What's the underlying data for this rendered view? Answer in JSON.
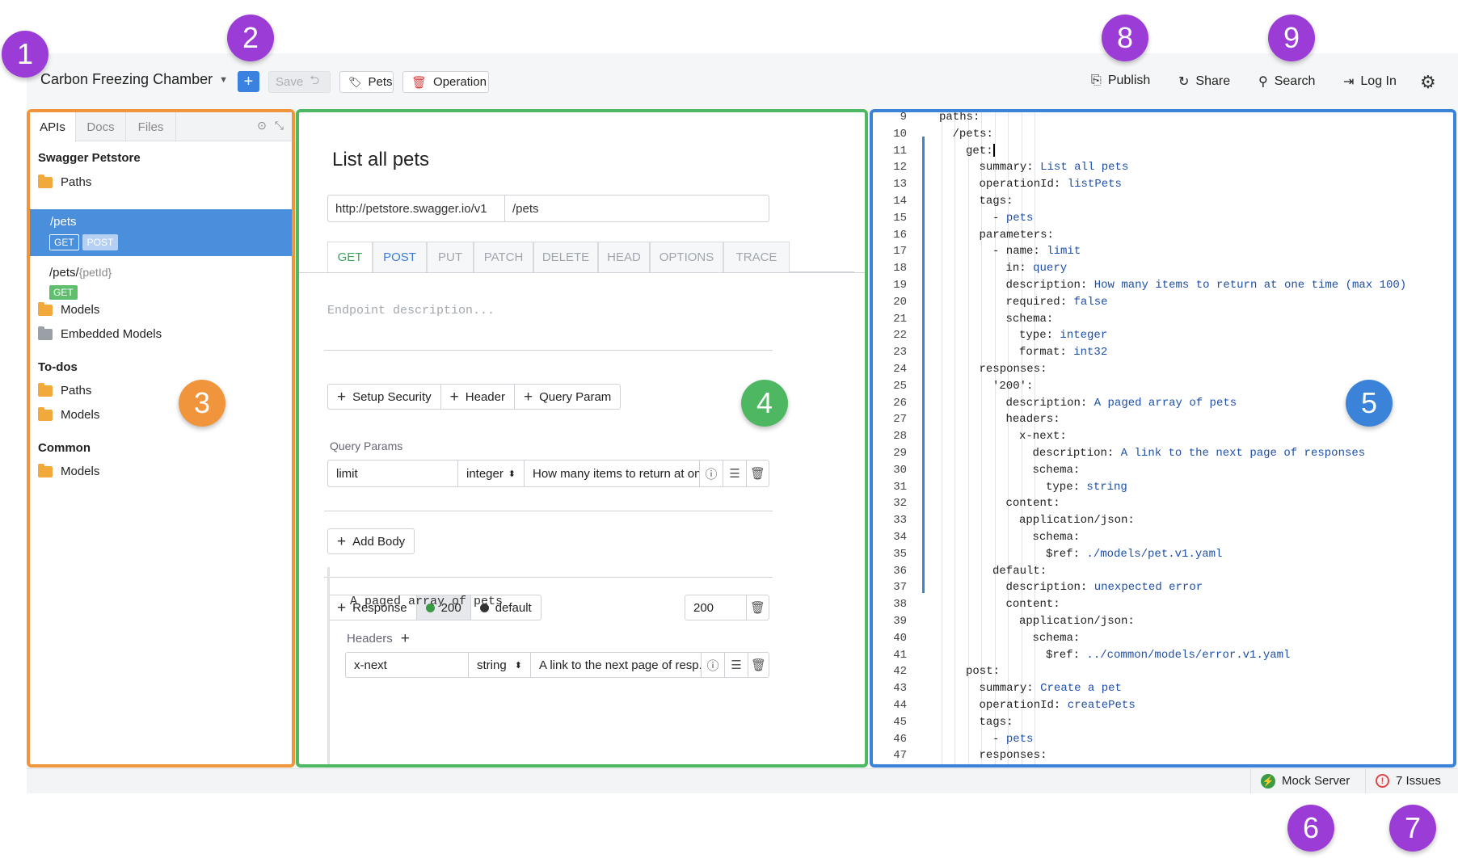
{
  "toolbar": {
    "project_title": "Carbon Freezing Chamber",
    "add_label": "+",
    "save_label": "Save",
    "pets_label": "Pets",
    "operation_label": "Operation",
    "publish_label": "Publish",
    "share_label": "Share",
    "search_label": "Search",
    "login_label": "Log In"
  },
  "callouts": [
    "1",
    "2",
    "3",
    "4",
    "5",
    "6",
    "7",
    "8",
    "9"
  ],
  "sidebar": {
    "tabs": [
      "APIs",
      "Docs",
      "Files"
    ],
    "sections": [
      {
        "title": "Swagger Petstore",
        "items": [
          "Paths"
        ]
      },
      {
        "title": "To-dos",
        "items": [
          "Paths",
          "Models"
        ]
      },
      {
        "title": "Common",
        "items": [
          "Models"
        ]
      }
    ],
    "paths": [
      {
        "path": "/pets",
        "methods": [
          "GET",
          "POST"
        ]
      },
      {
        "path_prefix": "/pets/",
        "path_param": "{petId}",
        "methods": [
          "GET"
        ]
      }
    ],
    "models_label": "Models",
    "embedded_models_label": "Embedded Models"
  },
  "operation": {
    "title": "List all pets",
    "base_url": "http://petstore.swagger.io/v1",
    "path": "/pets",
    "methods": [
      "GET",
      "POST",
      "PUT",
      "PATCH",
      "DELETE",
      "HEAD",
      "OPTIONS",
      "TRACE"
    ],
    "description_placeholder": "Endpoint description...",
    "setup_security": "Setup Security",
    "header": "Header",
    "query_param": "Query Param",
    "query_params_label": "Query Params",
    "query_param_row": {
      "name": "limit",
      "type": "integer",
      "description": "How many items to return at on..."
    },
    "add_body": "Add Body",
    "response_label": "Response",
    "response_codes": [
      "200",
      "default"
    ],
    "response_code_value": "200",
    "response_description": "A paged array of pets",
    "headers_label": "Headers",
    "header_row": {
      "name": "x-next",
      "type": "string",
      "description": "A link to the next page of resp..."
    }
  },
  "editor": {
    "lines": [
      {
        "n": "9",
        "indent": 0,
        "k": "paths:",
        "v": ""
      },
      {
        "n": "10",
        "indent": 1,
        "k": "/pets:",
        "v": ""
      },
      {
        "n": "11",
        "indent": 2,
        "k": "get:",
        "v": ""
      },
      {
        "n": "12",
        "indent": 3,
        "k": "summary: ",
        "v": "List all pets"
      },
      {
        "n": "13",
        "indent": 3,
        "k": "operationId: ",
        "v": "listPets"
      },
      {
        "n": "14",
        "indent": 3,
        "k": "tags:",
        "v": ""
      },
      {
        "n": "15",
        "indent": 4,
        "k": "- ",
        "v": "pets"
      },
      {
        "n": "16",
        "indent": 3,
        "k": "parameters:",
        "v": ""
      },
      {
        "n": "17",
        "indent": 4,
        "k": "- name: ",
        "v": "limit"
      },
      {
        "n": "18",
        "indent": 5,
        "k": "in: ",
        "v": "query"
      },
      {
        "n": "19",
        "indent": 5,
        "k": "description: ",
        "v": "How many items to return at one time (max 100)"
      },
      {
        "n": "20",
        "indent": 5,
        "k": "required: ",
        "v": "false"
      },
      {
        "n": "21",
        "indent": 5,
        "k": "schema:",
        "v": ""
      },
      {
        "n": "22",
        "indent": 6,
        "k": "type: ",
        "v": "integer"
      },
      {
        "n": "23",
        "indent": 6,
        "k": "format: ",
        "v": "int32"
      },
      {
        "n": "24",
        "indent": 3,
        "k": "responses:",
        "v": ""
      },
      {
        "n": "25",
        "indent": 4,
        "k": "'200':",
        "v": ""
      },
      {
        "n": "26",
        "indent": 5,
        "k": "description: ",
        "v": "A paged array of pets"
      },
      {
        "n": "27",
        "indent": 5,
        "k": "headers:",
        "v": ""
      },
      {
        "n": "28",
        "indent": 6,
        "k": "x-next:",
        "v": ""
      },
      {
        "n": "29",
        "indent": 7,
        "k": "description: ",
        "v": "A link to the next page of responses"
      },
      {
        "n": "30",
        "indent": 7,
        "k": "schema:",
        "v": ""
      },
      {
        "n": "31",
        "indent": 8,
        "k": "type: ",
        "v": "string"
      },
      {
        "n": "32",
        "indent": 5,
        "k": "content:",
        "v": ""
      },
      {
        "n": "33",
        "indent": 6,
        "k": "application/json:",
        "v": ""
      },
      {
        "n": "34",
        "indent": 7,
        "k": "schema:",
        "v": ""
      },
      {
        "n": "35",
        "indent": 8,
        "k": "$ref: ",
        "v": "./models/pet.v1.yaml"
      },
      {
        "n": "36",
        "indent": 4,
        "k": "default:",
        "v": ""
      },
      {
        "n": "37",
        "indent": 5,
        "k": "description: ",
        "v": "unexpected error"
      },
      {
        "n": "38",
        "indent": 5,
        "k": "content:",
        "v": ""
      },
      {
        "n": "39",
        "indent": 6,
        "k": "application/json:",
        "v": ""
      },
      {
        "n": "40",
        "indent": 7,
        "k": "schema:",
        "v": ""
      },
      {
        "n": "41",
        "indent": 8,
        "k": "$ref: ",
        "v": "../common/models/error.v1.yaml"
      },
      {
        "n": "42",
        "indent": 2,
        "k": "post:",
        "v": ""
      },
      {
        "n": "43",
        "indent": 3,
        "k": "summary: ",
        "v": "Create a pet"
      },
      {
        "n": "44",
        "indent": 3,
        "k": "operationId: ",
        "v": "createPets"
      },
      {
        "n": "45",
        "indent": 3,
        "k": "tags:",
        "v": ""
      },
      {
        "n": "46",
        "indent": 4,
        "k": "- ",
        "v": "pets"
      },
      {
        "n": "47",
        "indent": 3,
        "k": "responses:",
        "v": ""
      }
    ]
  },
  "statusbar": {
    "mock_server": "Mock Server",
    "issues": "7 Issues"
  },
  "colors": {
    "accent_blue": "#3b82e0",
    "callout_purple": "#9b3cd6",
    "frame_orange": "#f0953c",
    "frame_green": "#4db861",
    "frame_blue": "#3a83d8"
  }
}
